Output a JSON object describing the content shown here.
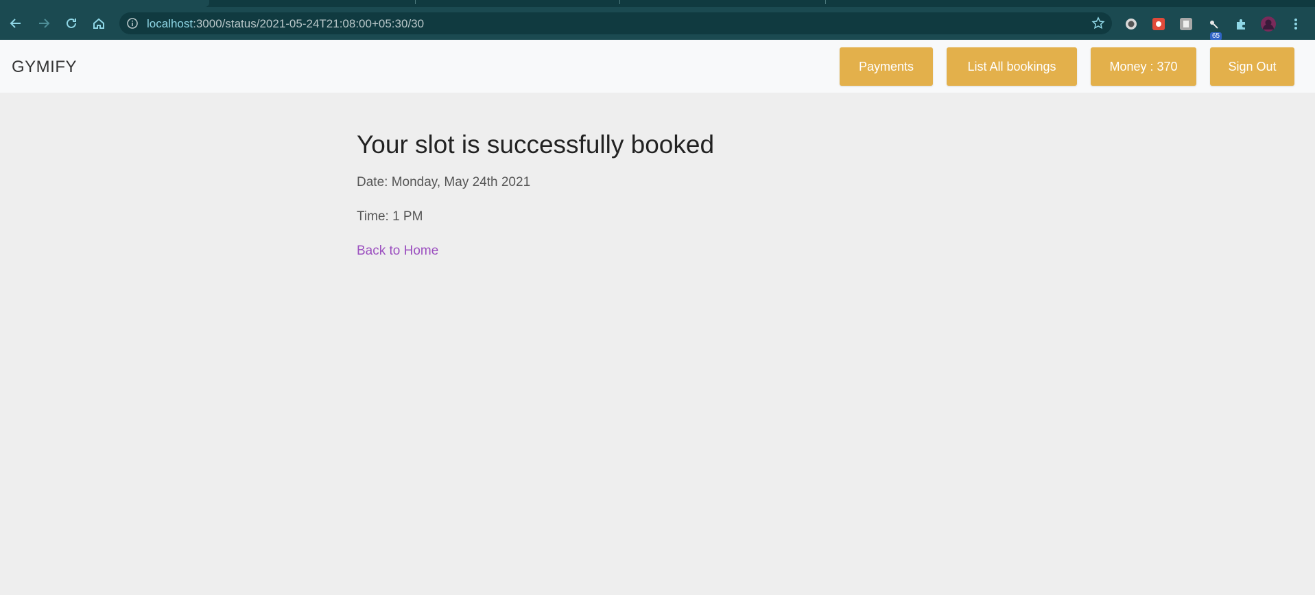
{
  "browser": {
    "url_host": "localhost",
    "url_rest": ":3000/status/2021-05-24T21:08:00+05:30/30",
    "extension_badge": "65"
  },
  "navbar": {
    "brand": "GYMIFY",
    "buttons": {
      "payments": "Payments",
      "list_bookings": "List All bookings",
      "money": "Money : 370",
      "sign_out": "Sign Out"
    }
  },
  "main": {
    "title": "Your slot is successfully booked",
    "date": "Date: Monday, May 24th 2021",
    "time": "Time: 1 PM",
    "back_link": "Back to Home"
  },
  "colors": {
    "accent_button": "#e3b04b",
    "link": "#9b4fbf",
    "browser_chrome": "#1b4a51"
  }
}
